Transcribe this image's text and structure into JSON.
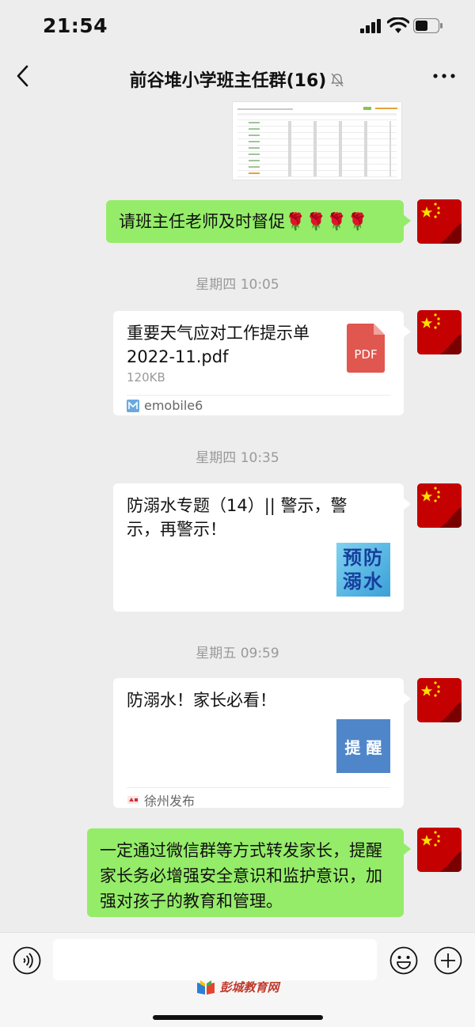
{
  "status_bar": {
    "time": "21:54"
  },
  "header": {
    "title": "前谷堆小学班主任群(16)"
  },
  "messages": {
    "m1": {
      "text": "请班主任老师及时督促🌹🌹🌹🌹"
    },
    "ts1": "星期四 10:05",
    "m2": {
      "title": "重要天气应对工作提示单2022-11.pdf",
      "size": "120KB",
      "file_icon_label": "PDF",
      "source": "emobile6"
    },
    "ts2": "星期四 10:35",
    "m3": {
      "title": "防溺水专题（14）|| 警示，警示，再警示！",
      "thumb_line1": "预防",
      "thumb_line2": "溺水"
    },
    "ts3": "星期五 09:59",
    "m4": {
      "title": "防溺水！家长必看！",
      "thumb_text": "提 醒",
      "source": "徐州发布"
    },
    "m5": {
      "text": "一定通过微信群等方式转发家长，提醒家长务必增强安全意识和监护意识，加强对孩子的教育和管理。"
    }
  },
  "input_bar": {
    "placeholder": ""
  },
  "watermark": {
    "text": "彭城教育网"
  },
  "colors": {
    "bubble_green": "#95ec69",
    "pdf_red": "#e0574f",
    "flag_red": "#c40000",
    "flag_star": "#ffde00"
  },
  "icons": [
    "back-arrow-icon",
    "mute-bell-icon",
    "more-dots-icon",
    "pdf-file-icon",
    "voice-icon",
    "emoji-icon",
    "plus-icon",
    "signal-icon",
    "wifi-icon",
    "battery-icon"
  ]
}
